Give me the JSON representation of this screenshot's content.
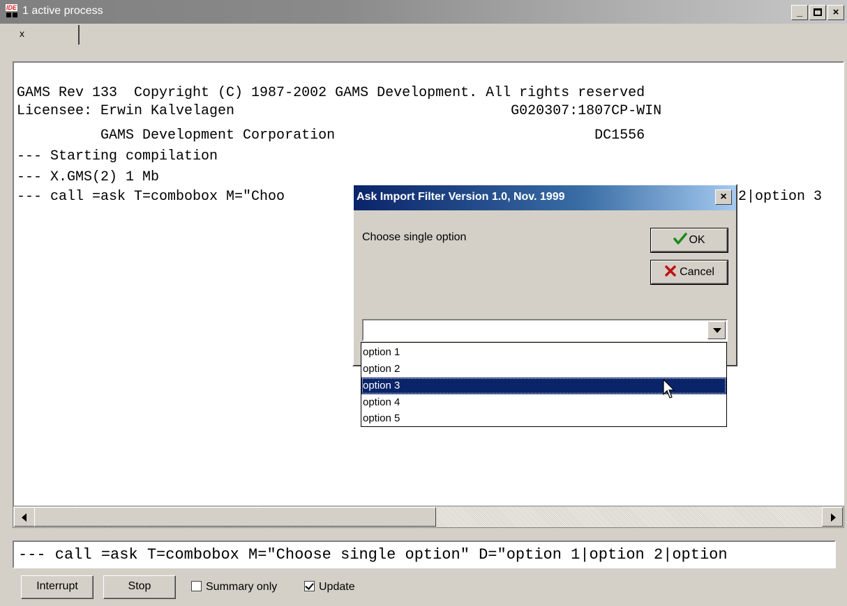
{
  "window": {
    "icon_label": "IDE",
    "title": "1 active process",
    "controls": {
      "minimize": "_",
      "close": "×"
    }
  },
  "tabs": [
    {
      "label": "x"
    }
  ],
  "output": {
    "lines": [
      "GAMS Rev 133  Copyright (C) 1987-2002 GAMS Development. All rights reserved",
      "Licensee: Erwin Kalvelagen                                 G020307:1807CP-WIN",
      "          GAMS Development Corporation                               DC1556",
      "--- Starting compilation",
      "--- X.GMS(2) 1 Mb",
      "--- call =ask T=combobox M=\"Choo",
      "2|option 3"
    ]
  },
  "command_line": "--- call =ask T=combobox M=\"Choose single option\" D=\"option 1|option 2|option",
  "bottom_bar": {
    "interrupt_label": "Interrupt",
    "stop_label": "Stop",
    "summary_only_label": "Summary only",
    "summary_only_checked": false,
    "update_label": "Update",
    "update_checked": true
  },
  "dialog": {
    "title": "Ask Import Filter Version 1.0, Nov. 1999",
    "close": "×",
    "prompt": "Choose single option",
    "ok_label": "OK",
    "cancel_label": "Cancel",
    "combo_value": "",
    "options": [
      "option 1",
      "option 2",
      "option 3",
      "option 4",
      "option 5"
    ],
    "highlighted_option": "option 3"
  }
}
